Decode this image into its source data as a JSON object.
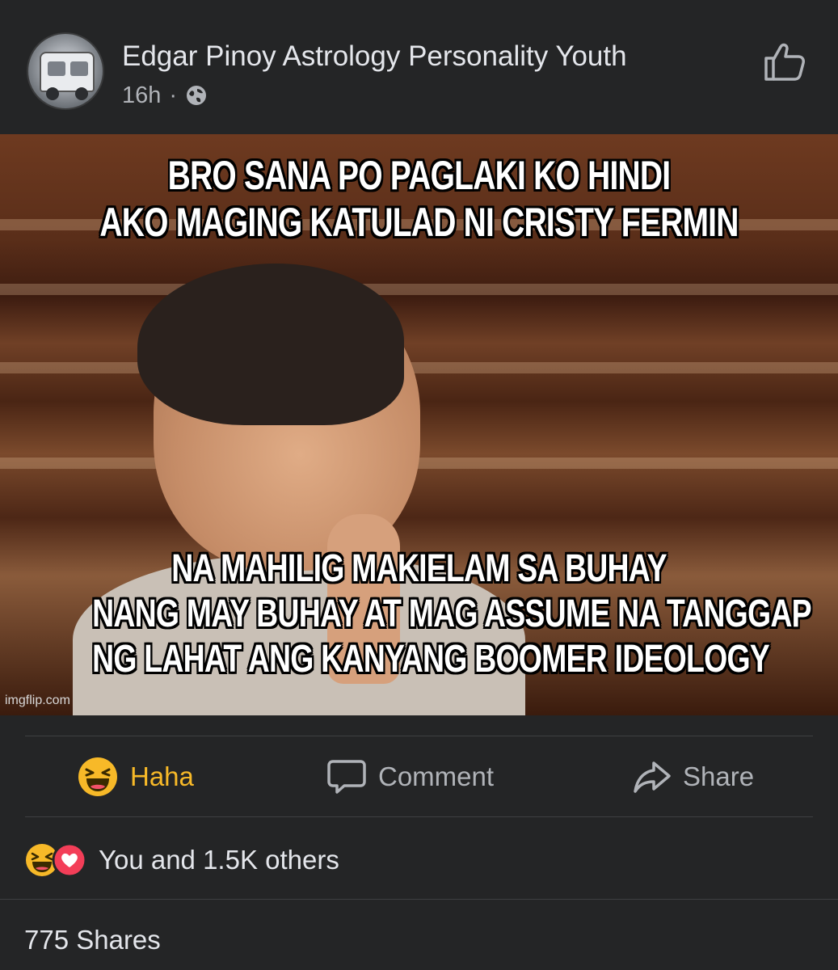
{
  "post": {
    "page_name": "Edgar Pinoy Astrology Personality Youth",
    "time": "16h",
    "separator": "·",
    "privacy_icon": "globe-icon",
    "like_page_icon": "thumbs-up-outline-icon"
  },
  "meme": {
    "caption_top": [
      "BRO SANA PO PAGLAKI KO HINDI",
      "AKO MAGING KATULAD NI CRISTY FERMIN"
    ],
    "caption_bottom": [
      "NA MAHILIG MAKIELAM SA BUHAY",
      "NANG MAY BUHAY AT MAG ASSUME NA TANGGAP",
      "NG LAHAT ANG KANYANG BOOMER IDEOLOGY"
    ],
    "watermark": "imgflip.com"
  },
  "actions": {
    "haha_label": "Haha",
    "comment_label": "Comment",
    "share_label": "Share",
    "haha_color": "#f7b928"
  },
  "reactions": {
    "summary": "You and 1.5K others",
    "icons": [
      "haha-reaction-icon",
      "love-reaction-icon"
    ]
  },
  "shares": {
    "summary": "775 Shares"
  },
  "colors": {
    "background": "#242526",
    "primary_text": "#e4e6eb",
    "secondary_text": "#b0b3b8",
    "divider": "#3e4042"
  }
}
